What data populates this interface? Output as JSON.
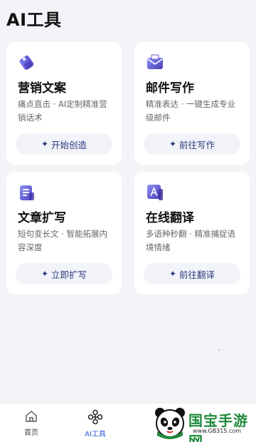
{
  "header": {
    "title": "AI工具"
  },
  "cards": [
    {
      "title": "营销文案",
      "desc": "痛点直击 · AI定制精准营销话术",
      "button": "开始创造"
    },
    {
      "title": "邮件写作",
      "desc": "精准表达 · 一键生成专业级邮件",
      "button": "前往写作"
    },
    {
      "title": "文章扩写",
      "desc": "短句变长文 · 智能拓展内容深度",
      "button": "立即扩写"
    },
    {
      "title": "在线翻译",
      "desc": "多语种秒翻 · 精准捕捉语境情绪",
      "button": "前往翻译"
    }
  ],
  "tabbar": {
    "home_label": "首页",
    "ai_label": "AI工具"
  },
  "watermark": {
    "title": "国宝手游网",
    "url": "www.GB315.com"
  },
  "colors": {
    "accent": "#2a57d8",
    "button_text": "#2b3a7a",
    "icon_purple": "#6b5bd6"
  },
  "icons": {
    "card1": "price-tag-icon",
    "card2": "envelope-icon",
    "card3": "document-icon",
    "card4": "translate-icon",
    "button": "sparkle-icon",
    "home": "home-icon",
    "ai": "ai-tools-icon"
  }
}
